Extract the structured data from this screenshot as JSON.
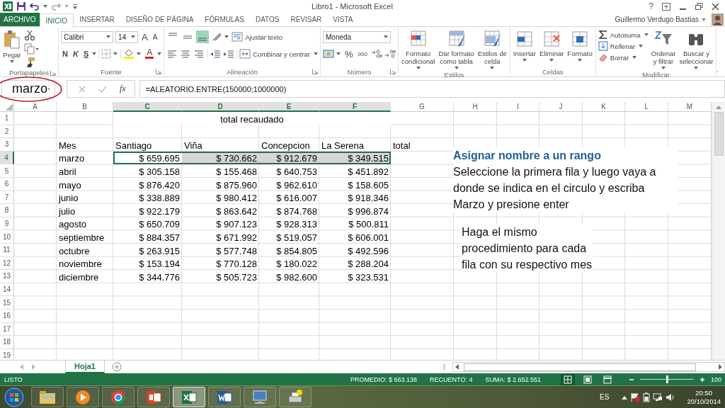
{
  "title_bar": {
    "title": "Libro1 - Microsoft Excel",
    "help": "?"
  },
  "tabs": [
    {
      "label": "ARCHIVO",
      "kind": "file",
      "selected": false
    },
    {
      "label": "INICIO",
      "kind": "tab",
      "selected": true
    },
    {
      "label": "INSERTAR",
      "kind": "tab",
      "selected": false
    },
    {
      "label": "DISEÑO DE PÁGINA",
      "kind": "tab",
      "selected": false
    },
    {
      "label": "FÓRMULAS",
      "kind": "tab",
      "selected": false
    },
    {
      "label": "DATOS",
      "kind": "tab",
      "selected": false
    },
    {
      "label": "REVISAR",
      "kind": "tab",
      "selected": false
    },
    {
      "label": "VISTA",
      "kind": "tab",
      "selected": false
    }
  ],
  "user": {
    "name": "Guillermo Verdugo Bastias"
  },
  "ribbon": [
    {
      "kind": "clipboard",
      "label": "Portapapeles",
      "paste": "Pegar"
    },
    {
      "kind": "font",
      "label": "Fuente",
      "font": "Calibri",
      "size": "14",
      "grow": "A",
      "shrink": "A",
      "bold": "N",
      "italic": "K",
      "underline": "S",
      "font_color": "A"
    },
    {
      "kind": "alignment",
      "label": "Alineación",
      "wrap": "Ajustar texto",
      "merge": "Combinar y centrar",
      "vertical": [
        {
          "selected": false
        },
        {
          "selected": false
        },
        {
          "selected": true
        }
      ]
    },
    {
      "kind": "number",
      "label": "Número",
      "format": "Moneda",
      "percent": "%",
      "thousands": "000"
    },
    {
      "kind": "large",
      "label": "Estilos",
      "buttons": [
        {
          "label": "Formato\ncondicional"
        },
        {
          "label": "Dar formato\ncomo tabla"
        },
        {
          "label": "Estilos de\ncelda"
        }
      ]
    },
    {
      "kind": "large",
      "label": "Celdas",
      "buttons": [
        {
          "label": "Insertar"
        },
        {
          "label": "Eliminar"
        },
        {
          "label": "Formato"
        }
      ]
    },
    {
      "kind": "editing",
      "label": "Modificar",
      "small": [
        {
          "label": "Autosuma"
        },
        {
          "label": "Rellenar"
        },
        {
          "label": "Borrar"
        }
      ],
      "buttons": [
        {
          "label": "Ordenar\ny filtrar"
        },
        {
          "label": "Buscar y\nseleccionar"
        }
      ]
    }
  ],
  "formula_bar": {
    "name_box": "marzo",
    "function_label": "fx",
    "formula": "=ALEATORIO.ENTRE(150000;1000000)"
  },
  "sheet": {
    "columns": [
      {
        "letter": "A",
        "selected": false
      },
      {
        "letter": "B",
        "selected": false
      },
      {
        "letter": "C",
        "selected": true
      },
      {
        "letter": "D",
        "selected": true
      },
      {
        "letter": "E",
        "selected": true
      },
      {
        "letter": "F",
        "selected": true
      },
      {
        "letter": "G",
        "selected": false
      },
      {
        "letter": "H",
        "selected": false
      },
      {
        "letter": "I",
        "selected": false
      },
      {
        "letter": "J",
        "selected": false
      },
      {
        "letter": "K",
        "selected": false
      },
      {
        "letter": "L",
        "selected": false
      },
      {
        "letter": "M",
        "selected": false
      }
    ],
    "rows": [
      {
        "number": "1",
        "selected": false,
        "cells": {
          "C": {
            "kind": "merged",
            "text": "total recaudado",
            "selected": false
          },
          "D": {
            "kind": "merged_part"
          },
          "E": {
            "kind": "merged_part"
          },
          "F": {
            "kind": "merged_part"
          }
        }
      },
      {
        "number": "2",
        "selected": false
      },
      {
        "number": "3",
        "selected": false,
        "cells": {
          "B": {
            "kind": "text",
            "text": "Mes",
            "selected": false
          },
          "C": {
            "kind": "text",
            "text": "Santiago",
            "selected": false
          },
          "D": {
            "kind": "text",
            "text": "Viña",
            "selected": false
          },
          "E": {
            "kind": "text",
            "text": "Concepcion",
            "selected": false
          },
          "F": {
            "kind": "text",
            "text": "La Serena",
            "selected": false
          },
          "G": {
            "kind": "text",
            "text": "total",
            "selected": false
          }
        }
      },
      {
        "number": "4",
        "selected": true,
        "cells": {
          "B": {
            "kind": "text",
            "text": "marzo",
            "selected": false
          },
          "C": {
            "kind": "number",
            "text": "$ 659.695",
            "selected": true
          },
          "D": {
            "kind": "number",
            "text": "$ 730.662",
            "selected": true
          },
          "E": {
            "kind": "number",
            "text": "$ 912.679",
            "selected": true
          },
          "F": {
            "kind": "number",
            "text": "$ 349.515",
            "selected": true
          }
        }
      },
      {
        "number": "5",
        "selected": false,
        "cells": {
          "B": {
            "kind": "text",
            "text": "abril",
            "selected": false
          },
          "C": {
            "kind": "number",
            "text": "$ 305.158",
            "selected": false
          },
          "D": {
            "kind": "number",
            "text": "$ 155.468",
            "selected": false
          },
          "E": {
            "kind": "number",
            "text": "$ 640.753",
            "selected": false
          },
          "F": {
            "kind": "number",
            "text": "$ 451.892",
            "selected": false
          }
        }
      },
      {
        "number": "6",
        "selected": false,
        "cells": {
          "B": {
            "kind": "text",
            "text": "mayo",
            "selected": false
          },
          "C": {
            "kind": "number",
            "text": "$ 876.420",
            "selected": false
          },
          "D": {
            "kind": "number",
            "text": "$ 875.960",
            "selected": false
          },
          "E": {
            "kind": "number",
            "text": "$ 962.610",
            "selected": false
          },
          "F": {
            "kind": "number",
            "text": "$ 158.605",
            "selected": false
          }
        }
      },
      {
        "number": "7",
        "selected": false,
        "cells": {
          "B": {
            "kind": "text",
            "text": "junio",
            "selected": false
          },
          "C": {
            "kind": "number",
            "text": "$ 338.889",
            "selected": false
          },
          "D": {
            "kind": "number",
            "text": "$ 980.412",
            "selected": false
          },
          "E": {
            "kind": "number",
            "text": "$ 616.007",
            "selected": false
          },
          "F": {
            "kind": "number",
            "text": "$ 918.346",
            "selected": false
          }
        }
      },
      {
        "number": "8",
        "selected": false,
        "cells": {
          "B": {
            "kind": "text",
            "text": "julio",
            "selected": false
          },
          "C": {
            "kind": "number",
            "text": "$ 922.179",
            "selected": false
          },
          "D": {
            "kind": "number",
            "text": "$ 863.642",
            "selected": false
          },
          "E": {
            "kind": "number",
            "text": "$ 874.768",
            "selected": false
          },
          "F": {
            "kind": "number",
            "text": "$ 996.874",
            "selected": false
          }
        }
      },
      {
        "number": "9",
        "selected": false,
        "cells": {
          "B": {
            "kind": "text",
            "text": "agosto",
            "selected": false
          },
          "C": {
            "kind": "number",
            "text": "$ 650.709",
            "selected": false
          },
          "D": {
            "kind": "number",
            "text": "$ 907.123",
            "selected": false
          },
          "E": {
            "kind": "number",
            "text": "$ 928.313",
            "selected": false
          },
          "F": {
            "kind": "number",
            "text": "$ 500.811",
            "selected": false
          }
        }
      },
      {
        "number": "10",
        "selected": false,
        "cells": {
          "B": {
            "kind": "text",
            "text": "septiembre",
            "selected": false
          },
          "C": {
            "kind": "number",
            "text": "$ 884.357",
            "selected": false
          },
          "D": {
            "kind": "number",
            "text": "$ 671.992",
            "selected": false
          },
          "E": {
            "kind": "number",
            "text": "$ 519.057",
            "selected": false
          },
          "F": {
            "kind": "number",
            "text": "$ 606.001",
            "selected": false
          }
        }
      },
      {
        "number": "11",
        "selected": false,
        "cells": {
          "B": {
            "kind": "text",
            "text": "octubre",
            "selected": false
          },
          "C": {
            "kind": "number",
            "text": "$ 263.915",
            "selected": false
          },
          "D": {
            "kind": "number",
            "text": "$ 577.748",
            "selected": false
          },
          "E": {
            "kind": "number",
            "text": "$ 854.805",
            "selected": false
          },
          "F": {
            "kind": "number",
            "text": "$ 492.596",
            "selected": false
          }
        }
      },
      {
        "number": "12",
        "selected": false,
        "cells": {
          "B": {
            "kind": "text",
            "text": "noviembre",
            "selected": false
          },
          "C": {
            "kind": "number",
            "text": "$ 153.194",
            "selected": false
          },
          "D": {
            "kind": "number",
            "text": "$ 770.128",
            "selected": false
          },
          "E": {
            "kind": "number",
            "text": "$ 180.022",
            "selected": false
          },
          "F": {
            "kind": "number",
            "text": "$ 288.204",
            "selected": false
          }
        }
      },
      {
        "number": "13",
        "selected": false,
        "cells": {
          "B": {
            "kind": "text",
            "text": "diciembre",
            "selected": false
          },
          "C": {
            "kind": "number",
            "text": "$ 344.776",
            "selected": false
          },
          "D": {
            "kind": "number",
            "text": "$ 505.723",
            "selected": false
          },
          "E": {
            "kind": "number",
            "text": "$ 982.600",
            "selected": false
          },
          "F": {
            "kind": "number",
            "text": "$ 323.531",
            "selected": false
          }
        }
      },
      {
        "number": "14",
        "selected": false
      },
      {
        "number": "15",
        "selected": false
      },
      {
        "number": "16",
        "selected": false
      },
      {
        "number": "17",
        "selected": false
      },
      {
        "number": "18",
        "selected": false
      },
      {
        "number": "19",
        "selected": false
      }
    ]
  },
  "annotations": [
    {
      "kind": "heading_note",
      "title": "Asignar nombre a un rango",
      "text": "Seleccione la primera fila y luego vaya a donde se indica en el circulo y escriba Marzo y presione enter"
    },
    {
      "kind": "note",
      "text": "Haga el mismo procedimiento para cada fila con su respectivo mes"
    }
  ],
  "sheet_tabs": [
    {
      "label": "Hoja1",
      "selected": true
    }
  ],
  "status_bar": {
    "mode": "LISTO",
    "stats": [
      "PROMEDIO: $ 663.138",
      "RECUENTO: 4",
      "SUMA: $ 2.652.551"
    ],
    "views": [
      {
        "selected": true
      },
      {
        "selected": false
      },
      {
        "selected": false
      }
    ],
    "zoom": {
      "level": 0.5
    },
    "zoom_label": "100"
  },
  "taskbar": {
    "apps": [
      {
        "selected": false
      },
      {
        "selected": false
      },
      {
        "selected": false
      },
      {
        "selected": false
      },
      {
        "selected": true
      },
      {
        "selected": false
      },
      {
        "selected": false
      },
      {
        "selected": false
      }
    ],
    "language": "ES",
    "time": "20:50",
    "date": "20/10/2014"
  }
}
